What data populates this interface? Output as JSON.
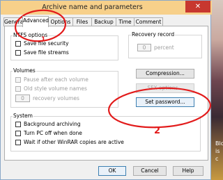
{
  "window": {
    "title": "Archive name and parameters",
    "close_glyph": "✕"
  },
  "tabs": [
    "General",
    "Advanced",
    "Options",
    "Files",
    "Backup",
    "Time",
    "Comment"
  ],
  "ntfs": {
    "title": "NTFS options",
    "items": [
      "Save file security",
      "Save file streams"
    ]
  },
  "recovery": {
    "title": "Recovery record",
    "value": "0",
    "unit": "percent"
  },
  "volumes": {
    "title": "Volumes",
    "items": [
      "Pause after each volume",
      "Old style volume names"
    ],
    "recovery_value": "0",
    "recovery_label": "recovery volumes"
  },
  "buttons": {
    "compression": "Compression...",
    "sfx": "SFX options...",
    "set_password": "Set password..."
  },
  "system": {
    "title": "System",
    "items": [
      "Background archiving",
      "Turn PC off when done",
      "Wait if other WinRAR copies are active"
    ]
  },
  "footer": {
    "ok": "OK",
    "cancel": "Cancel",
    "help": "Help"
  },
  "annotations": {
    "one": "1",
    "two": "2",
    "color": "#e21b1b"
  },
  "background": {
    "text": "Blo\nis\nc"
  }
}
